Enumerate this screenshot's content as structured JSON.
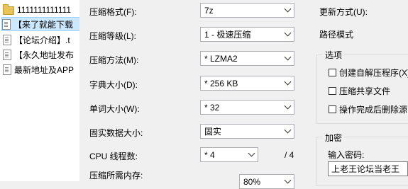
{
  "filelist": {
    "items": [
      {
        "name": "1111111111111",
        "icon": "folder-icon"
      },
      {
        "name": "【来了就能下载",
        "icon": "doc-icon",
        "selected": true
      },
      {
        "name": "【论坛介绍】.t",
        "icon": "doc-icon"
      },
      {
        "name": "【永久地址发布",
        "icon": "doc-icon"
      },
      {
        "name": "最新地址及APP",
        "icon": "doc-icon"
      }
    ]
  },
  "settings": {
    "format_label": "压缩格式(F):",
    "format_value": "7z",
    "level_label": "压缩等级(L):",
    "level_value": "1 - 极速压缩",
    "method_label": "压缩方法(M):",
    "method_value": "* LZMA2",
    "dict_label": "字典大小(D):",
    "dict_value": "* 256 KB",
    "word_label": "单词大小(W):",
    "word_value": "* 32",
    "solid_label": "固实数据大小:",
    "solid_value": "固实",
    "threads_label": "CPU 线程数:",
    "threads_value": "* 4",
    "threads_total": "/ 4",
    "memory_label": "压缩所需内存:",
    "memory_value": "80%"
  },
  "right": {
    "update_label": "更新方式(U):",
    "path_label": "路径模式",
    "options_title": "选项",
    "options": [
      "创建自解压程序(X)",
      "压缩共享文件",
      "操作完成后删除源"
    ],
    "encrypt_title": "加密",
    "password_label": "输入密码:",
    "password_value": "上老王论坛当老王"
  }
}
